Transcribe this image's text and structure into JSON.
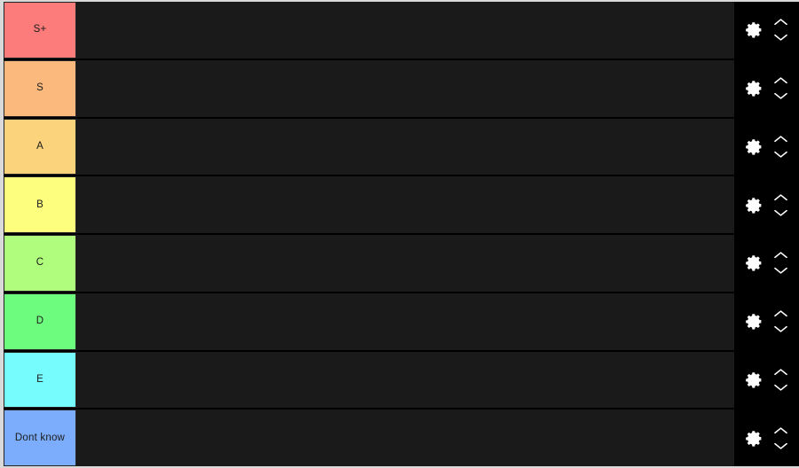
{
  "app": {
    "name": "tier-list-maker",
    "background_color": "#d9d9d9",
    "drop_area_color": "#1a1a1a",
    "controls_panel_color": "#000000",
    "row_divider_color": "#000000",
    "label_text_color": "#1b1b1b"
  },
  "controls": {
    "settings_icon": "gear-icon",
    "move_up_icon": "chevron-up-icon",
    "move_down_icon": "chevron-down-icon"
  },
  "tiers": [
    {
      "label": "S+",
      "color": "#fc7c7c",
      "items": []
    },
    {
      "label": "S",
      "color": "#fcb97d",
      "items": []
    },
    {
      "label": "A",
      "color": "#fcd37d",
      "items": []
    },
    {
      "label": "B",
      "color": "#fdfd7e",
      "items": []
    },
    {
      "label": "C",
      "color": "#b0fc7d",
      "items": []
    },
    {
      "label": "D",
      "color": "#6dfc7d",
      "items": []
    },
    {
      "label": "E",
      "color": "#76fcfc",
      "items": []
    },
    {
      "label": "Dont know",
      "color": "#7badfc",
      "items": []
    }
  ]
}
